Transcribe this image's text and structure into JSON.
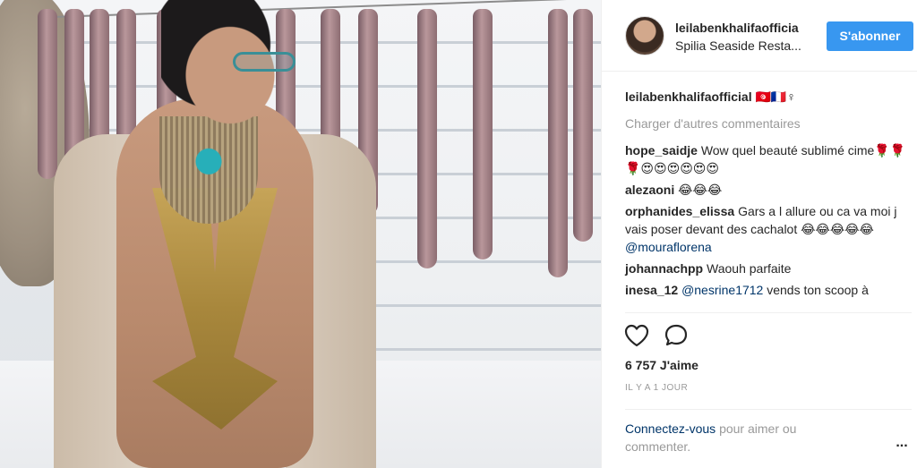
{
  "post": {
    "author": {
      "username": "leilabenkhalifaofficia",
      "location": "Spilia Seaside Resta..."
    },
    "follow_button": "S'abonner",
    "caption": {
      "user": "leilabenkhalifaofficial",
      "text": "🇹🇳🇫🇷♀"
    },
    "load_more": "Charger d'autres commentaires",
    "comments": [
      {
        "user": "hope_saidje",
        "text": "Wow quel beauté sublimé cime🌹🌹🌹😍😍😍😍😍😍",
        "mention": ""
      },
      {
        "user": "alezaoni",
        "text": "😂😂😂",
        "mention": ""
      },
      {
        "user": "orphanides_elissa",
        "text": "Gars a l allure ou ca va moi j vais poser devant des cachalot 😂😂😂😂😂",
        "mention": "@mouraflorena"
      },
      {
        "user": "johannachpp",
        "text": "Waouh parfaite",
        "mention": ""
      },
      {
        "user": "inesa_12",
        "text": "vends ton scoop à",
        "mention": "@nesrine1712"
      }
    ],
    "actions": {
      "like_icon": "heart-icon",
      "comment_icon": "speech-bubble-icon"
    },
    "likes": "6 757 J'aime",
    "timestamp": "IL Y A 1 JOUR",
    "login_prompt": {
      "link": "Connectez-vous",
      "rest": "pour aimer ou commenter."
    },
    "more_options": "..."
  },
  "colors": {
    "accent": "#3897f0",
    "link": "#003569",
    "muted": "#999999",
    "text": "#262626",
    "border": "#efefef"
  }
}
